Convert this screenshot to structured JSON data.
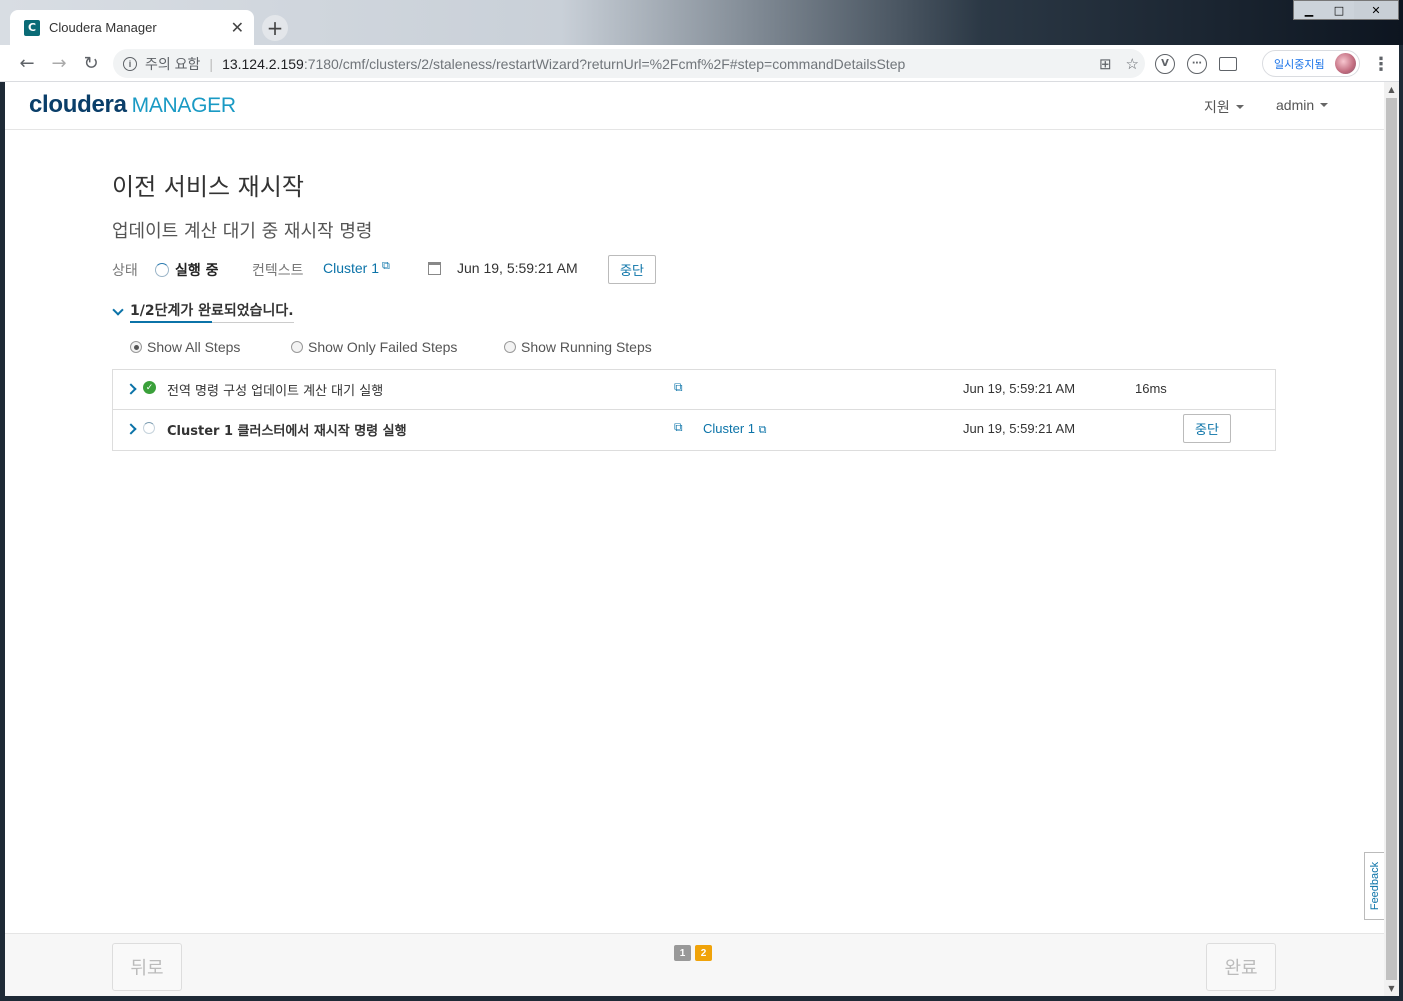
{
  "browser": {
    "tab_title": "Cloudera Manager",
    "tab_favicon": "C",
    "close_glyph": "✕",
    "newtab_glyph": "+",
    "security_label": "주의 요함",
    "url_host": "13.124.2.159",
    "url_rest": ":7180/cmf/clusters/2/staleness/restartWizard?returnUrl=%2Fcmf%2F#step=commandDetailsStep",
    "profile_label": "일시중지됨",
    "icons": [
      "back-icon",
      "forward-icon",
      "reload-icon",
      "info-icon",
      "translate-icon",
      "star-icon",
      "extension-v-icon",
      "extension-code-icon",
      "cast-icon",
      "menu-icon"
    ]
  },
  "header": {
    "logo_part1": "cloudera",
    "logo_part2": "MANAGER",
    "support_menu": "지원",
    "user_menu": "admin"
  },
  "page": {
    "title": "이전 서비스 재시작",
    "subtitle": "업데이트 계산 대기 중 재시작 명령",
    "status_label": "상태",
    "status_value": "실행 중",
    "context_label": "컨텍스트",
    "context_value": "Cluster 1",
    "start_time": "Jun 19, 5:59:21 AM",
    "abort_label": "중단",
    "progress_text": "1/2단계가 완료되었습니다.",
    "progress_fraction": 0.5
  },
  "filters": [
    {
      "label": "Show All Steps",
      "selected": true
    },
    {
      "label": "Show Only Failed Steps",
      "selected": false
    },
    {
      "label": "Show Running Steps",
      "selected": false
    }
  ],
  "steps": [
    {
      "name": "전역 명령 구성 업데이트 계산 대기 실행",
      "state": "success",
      "context": "",
      "time": "Jun 19, 5:59:21 AM",
      "duration": "16ms",
      "action": ""
    },
    {
      "name": "Cluster 1 클러스터에서 재시작 명령 실행",
      "state": "running",
      "context": "Cluster 1",
      "time": "Jun 19, 5:59:21 AM",
      "duration": "",
      "action": "중단"
    }
  ],
  "footer": {
    "back_label": "뒤로",
    "finish_label": "완료",
    "pages": [
      "1",
      "2"
    ],
    "current_page": "2"
  },
  "feedback_label": "Feedback",
  "colors": {
    "accent": "#0b73a8",
    "success": "#3aa03a",
    "current_page": "#f0a30a"
  }
}
